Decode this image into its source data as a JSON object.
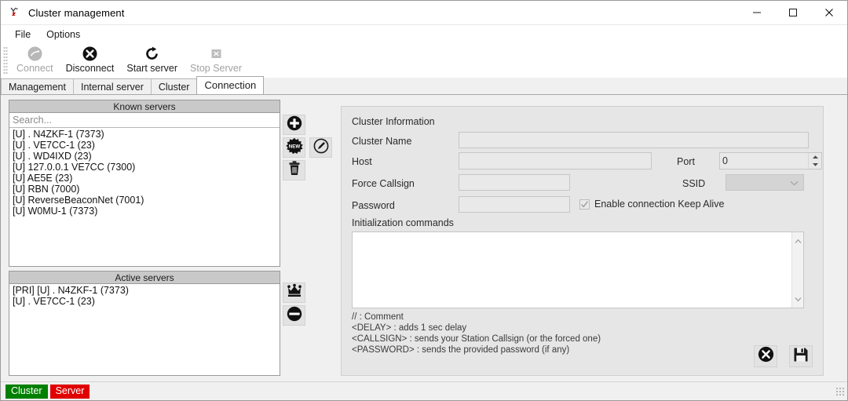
{
  "window": {
    "title": "Cluster management",
    "icon": "antenna-icon",
    "minimize": "—",
    "maximize": "□",
    "close": "✕"
  },
  "menu": {
    "items": [
      {
        "label": "File",
        "name": "menu-file"
      },
      {
        "label": "Options",
        "name": "menu-options"
      }
    ]
  },
  "toolbar": {
    "items": [
      {
        "label": "Connect",
        "icon": "connect-icon",
        "disabled": true
      },
      {
        "label": "Disconnect",
        "icon": "disconnect-icon",
        "disabled": false
      },
      {
        "label": "Start server",
        "icon": "refresh-icon",
        "disabled": false
      },
      {
        "label": "Stop Server",
        "icon": "stop-icon",
        "disabled": true
      }
    ]
  },
  "tabs": [
    {
      "label": "Management",
      "active": false
    },
    {
      "label": "Internal server",
      "active": false
    },
    {
      "label": "Cluster",
      "active": false
    },
    {
      "label": "Connection",
      "active": true
    }
  ],
  "known_servers": {
    "title": "Known servers",
    "search_placeholder": "Search...",
    "search_value": "",
    "rows": [
      "[U] . N4ZKF-1 (7373)",
      "[U] . VE7CC-1 (23)",
      "[U] . WD4IXD (23)",
      "[U] 127.0.0.1 VE7CC (7300)",
      "[U] AE5E (23)",
      "[U] RBN (7000)",
      "[U] ReverseBeaconNet (7001)",
      "[U] W0MU-1 (7373)"
    ],
    "buttons": [
      {
        "name": "add-server-button",
        "icon": "plus-circle-icon"
      },
      {
        "name": "new-server-button",
        "icon": "new-burst-icon",
        "badge": "NEW"
      },
      {
        "name": "edit-server-button",
        "icon": "edit-pencil-icon"
      },
      {
        "name": "delete-server-button",
        "icon": "trash-icon"
      }
    ]
  },
  "active_servers": {
    "title": "Active servers",
    "rows": [
      "[PRI] [U] . N4ZKF-1 (7373)",
      "[U] . VE7CC-1 (23)"
    ],
    "buttons": [
      {
        "name": "set-primary-button",
        "icon": "crown-icon"
      },
      {
        "name": "remove-active-button",
        "icon": "minus-circle-icon"
      }
    ]
  },
  "cluster_information": {
    "section_title": "Cluster Information",
    "fields": {
      "cluster_name_label": "Cluster Name",
      "cluster_name_value": "",
      "host_label": "Host",
      "host_value": "",
      "port_label": "Port",
      "port_value": "0",
      "force_callsign_label": "Force Callsign",
      "force_callsign_value": "",
      "ssid_label": "SSID",
      "ssid_value": "",
      "password_label": "Password",
      "password_value": "",
      "keepalive_label": "Enable connection Keep Alive",
      "keepalive_checked": true
    },
    "init_commands_label": "Initialization commands",
    "init_commands_value": "",
    "help_lines": [
      "// : Comment",
      "<DELAY> : adds 1 sec delay",
      "<CALLSIGN> : sends your Station Callsign (or the forced one)",
      "<PASSWORD> : sends the provided password (if any)"
    ],
    "buttons": [
      {
        "name": "cancel-button",
        "icon": "cancel-circle-icon"
      },
      {
        "name": "save-button",
        "icon": "floppy-save-icon"
      }
    ]
  },
  "statusbar": {
    "badges": [
      {
        "label": "Cluster",
        "color": "#008000"
      },
      {
        "label": "Server",
        "color": "#e00000"
      }
    ]
  }
}
